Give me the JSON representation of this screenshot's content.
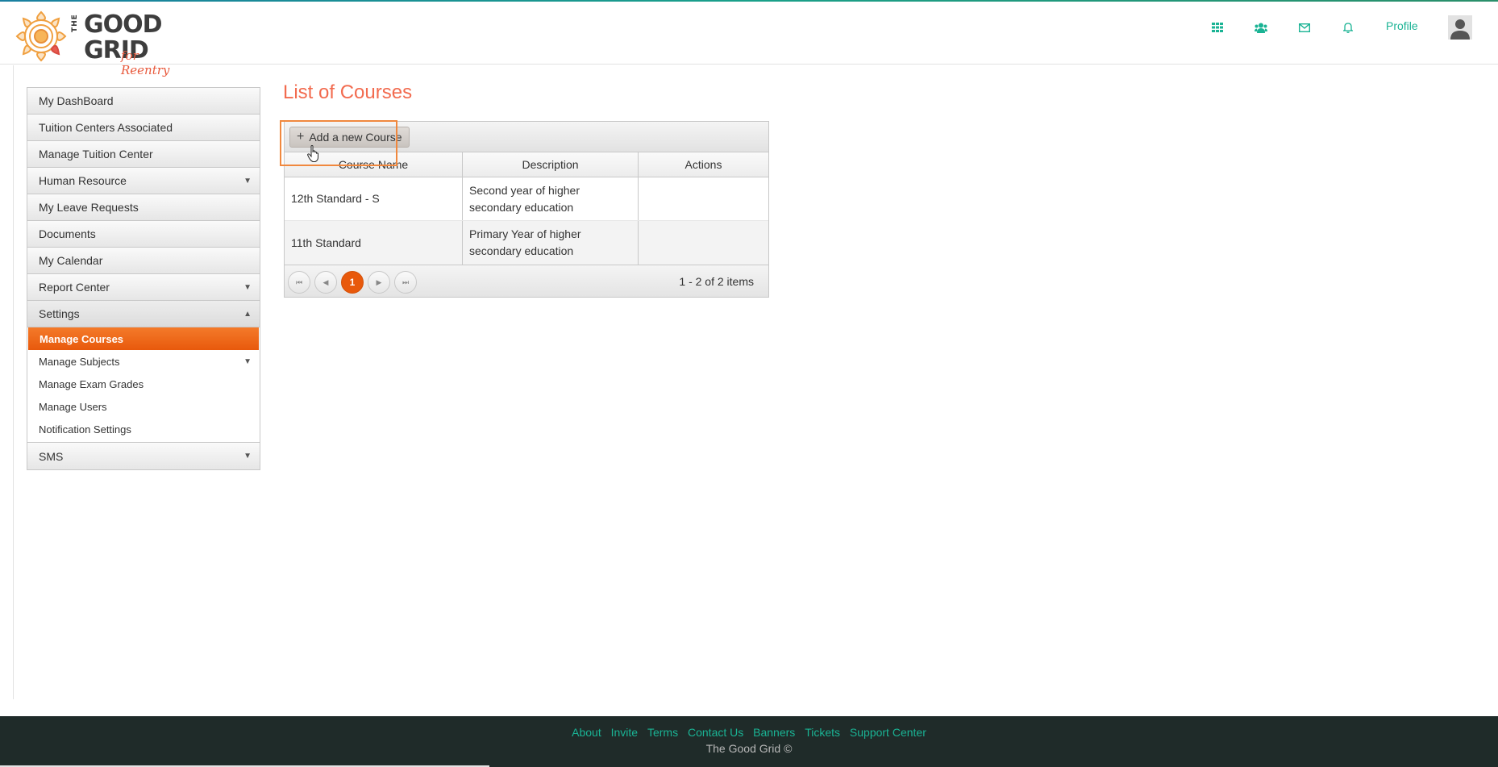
{
  "header": {
    "logo": {
      "the": "THE",
      "line1": "GOOD",
      "line2": "GRID",
      "sub": "for Reentry"
    },
    "nav_icons": [
      "apps-grid-icon",
      "users-icon",
      "mail-icon",
      "bell-icon"
    ],
    "profile_label": "Profile"
  },
  "sidebar": {
    "items": [
      {
        "label": "My DashBoard"
      },
      {
        "label": "Tuition Centers Associated"
      },
      {
        "label": "Manage Tuition Center"
      },
      {
        "label": "Human Resource",
        "arrow": "▼"
      },
      {
        "label": "My Leave Requests"
      },
      {
        "label": "Documents"
      },
      {
        "label": "My Calendar"
      },
      {
        "label": "Report Center",
        "arrow": "▼"
      },
      {
        "label": "Settings",
        "arrow": "▲"
      }
    ],
    "settings_sub": [
      {
        "label": "Manage Courses"
      },
      {
        "label": "Manage Subjects",
        "arrow": "▼"
      },
      {
        "label": "Manage Exam Grades"
      },
      {
        "label": "Manage Users"
      },
      {
        "label": "Notification Settings"
      }
    ],
    "last_item": {
      "label": "SMS",
      "arrow": "▼"
    }
  },
  "main": {
    "page_title": "List of Courses",
    "add_button": {
      "icon": "+",
      "label": "Add a new Course"
    },
    "columns": [
      "Course Name",
      "Description",
      "Actions"
    ],
    "rows": [
      {
        "course_name": "12th Standard - S",
        "description": "Second year of higher secondary education",
        "actions": ""
      },
      {
        "course_name": "11th Standard",
        "description": "Primary Year of higher secondary education",
        "actions": ""
      }
    ],
    "pager": {
      "first": "⏮",
      "prev": "◀",
      "current_page": "1",
      "next": "▶",
      "last": "⏭",
      "info": "1 - 2 of 2 items"
    }
  },
  "footer": {
    "links": [
      "About",
      "Invite",
      "Terms",
      "Contact Us",
      "Banners",
      "Tickets",
      "Support Center"
    ],
    "copyright": "The Good Grid ©"
  },
  "colors": {
    "accent": "#1ab394",
    "title": "#f26b4f",
    "active": "#e8590c",
    "footer_bg": "#1f2b29",
    "highlight": "#f0883e"
  }
}
